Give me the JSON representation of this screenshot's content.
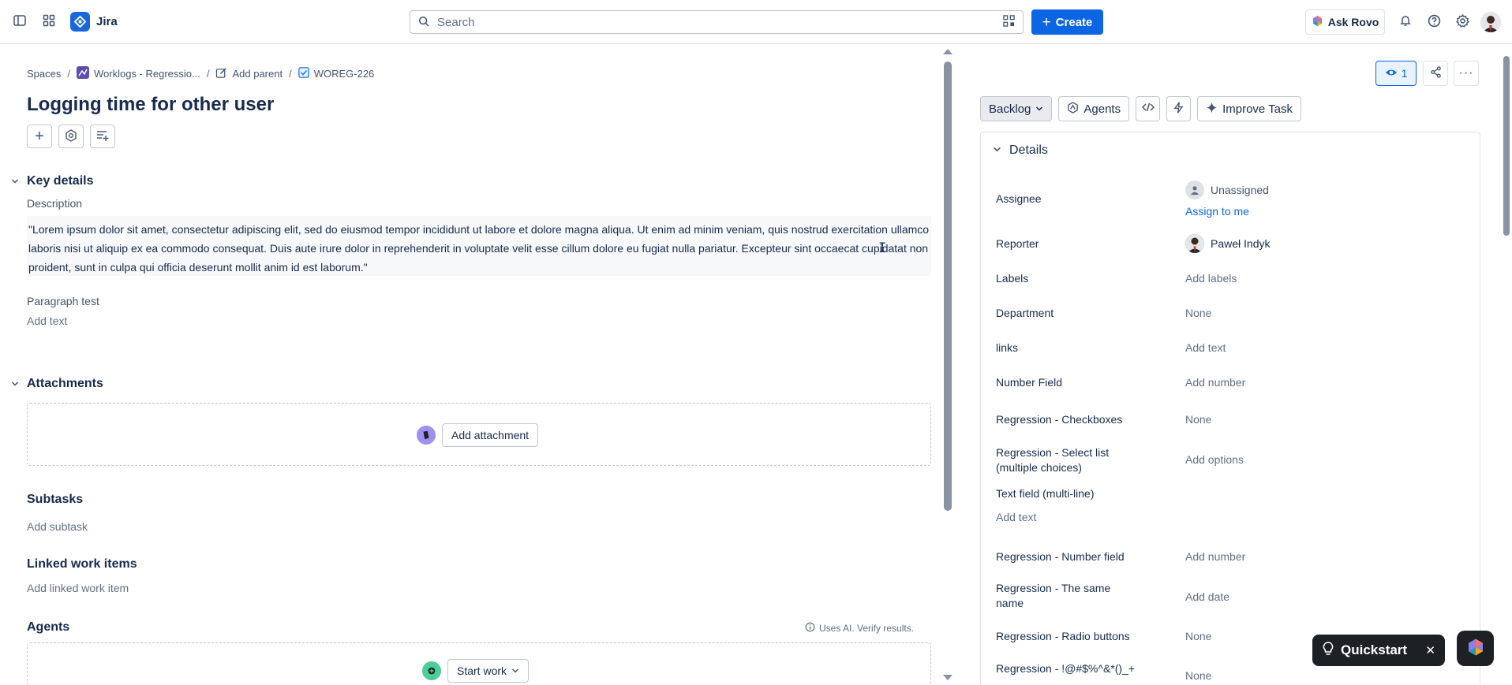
{
  "topbar": {
    "app_name": "Jira",
    "search_placeholder": "Search",
    "create_label": "Create",
    "ask_rovo_label": "Ask Rovo"
  },
  "breadcrumb": {
    "spaces": "Spaces",
    "project": "Worklogs - Regressio...",
    "add_parent": "Add parent",
    "issue_key": "WOREG-226"
  },
  "issue": {
    "title": "Logging time for other user"
  },
  "key_details": {
    "heading": "Key details",
    "description_label": "Description",
    "description_text": "\"Lorem ipsum dolor sit amet, consectetur adipiscing elit, sed do eiusmod tempor incididunt ut labore et dolore magna aliqua. Ut enim ad minim veniam, quis nostrud exercitation ullamco laboris nisi ut aliquip ex ea commodo consequat. Duis aute irure dolor in reprehenderit in voluptate velit esse cillum dolore eu fugiat nulla pariatur. Excepteur sint occaecat cupidatat non proident, sunt in culpa qui officia deserunt mollit anim id est laborum.\"",
    "paragraph_label": "Paragraph test",
    "paragraph_placeholder": "Add text"
  },
  "attachments": {
    "heading": "Attachments",
    "add_label": "Add attachment"
  },
  "subtasks": {
    "heading": "Subtasks",
    "add_label": "Add subtask"
  },
  "linked": {
    "heading": "Linked work items",
    "add_label": "Add linked work item"
  },
  "agents": {
    "heading": "Agents",
    "ai_note": "Uses AI. Verify results.",
    "start_label": "Start work"
  },
  "right": {
    "watch_count": "1",
    "status_label": "Backlog",
    "agents_label": "Agents",
    "improve_label": "Improve Task",
    "details_heading": "Details",
    "fields": {
      "assignee_label": "Assignee",
      "assignee_value": "Unassigned",
      "assign_to_me": "Assign to me",
      "reporter_label": "Reporter",
      "reporter_value": "Paweł Indyk",
      "labels_label": "Labels",
      "labels_value": "Add labels",
      "department_label": "Department",
      "department_value": "None",
      "links_label": "links",
      "links_value": "Add text",
      "number_label": "Number Field",
      "number_value": "Add number",
      "checkboxes_label": "Regression - Checkboxes",
      "checkboxes_value": "None",
      "select_label": "Regression - Select list (multiple choices)",
      "select_value": "Add options",
      "textml_label": "Text field (multi-line)",
      "textml_value": "Add text",
      "regnum_label": "Regression - Number field",
      "regnum_value": "Add number",
      "samename_label": "Regression - The same name",
      "samename_value": "Add date",
      "radio_label": "Regression - Radio buttons",
      "radio_value": "None",
      "special_label": "Regression - !@#$%^&*()_+",
      "special_value": "None"
    }
  },
  "quickstart": {
    "label": "Quickstart"
  },
  "colors": {
    "brand": "#0c66e4",
    "text": "#172b4d",
    "subtle": "#626f86"
  }
}
